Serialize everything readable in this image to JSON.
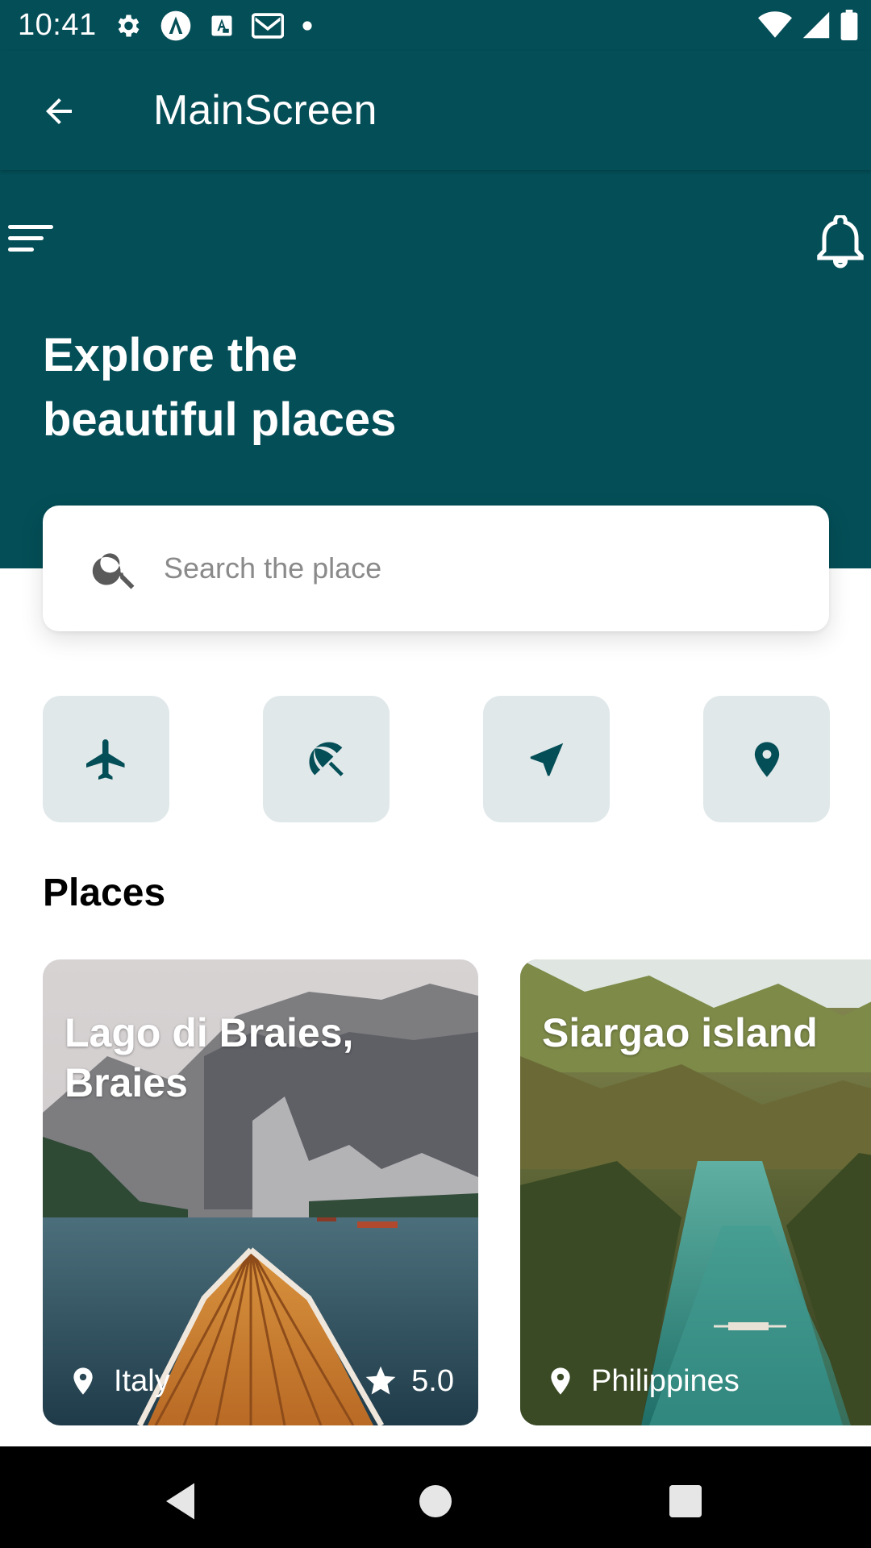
{
  "status_bar": {
    "time": "10:41",
    "left_icons": [
      "settings-icon",
      "a-circle-icon",
      "a-box-icon",
      "gmail-icon",
      "dot-icon"
    ],
    "right_icons": [
      "wifi-icon",
      "signal-icon",
      "battery-icon"
    ]
  },
  "app_bar": {
    "title": "MainScreen",
    "back_icon": "arrow-left-icon"
  },
  "hero": {
    "title_line1": "Explore the",
    "title_line2": "beautiful places",
    "menu_icon": "menu-icon",
    "bell_icon": "bell-icon"
  },
  "search": {
    "placeholder": "Search the place",
    "value": ""
  },
  "categories": [
    {
      "icon": "airplane-icon"
    },
    {
      "icon": "beach-umbrella-icon"
    },
    {
      "icon": "navigation-arrow-icon"
    },
    {
      "icon": "location-pin-icon"
    }
  ],
  "places": {
    "title": "Places",
    "items": [
      {
        "name": "Lago di Braies, Braies",
        "location": "Italy",
        "rating": "5.0"
      },
      {
        "name": "Siargao island",
        "location": "Philippines",
        "rating": ""
      }
    ]
  },
  "colors": {
    "primary": "#044e57",
    "category_bg": "#e0e8ea",
    "white": "#ffffff"
  }
}
